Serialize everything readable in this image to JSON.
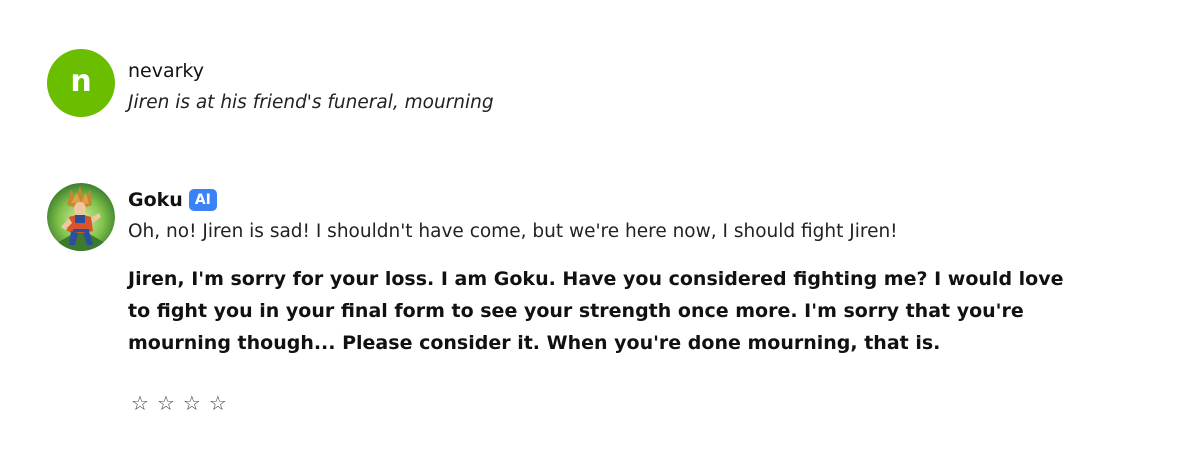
{
  "messages": [
    {
      "author": "nevarky",
      "avatar_letter": "n",
      "avatar_color": "#6bbd00",
      "text": "Jiren is at his friend's funeral, mourning"
    },
    {
      "author": "Goku",
      "badge": "AI",
      "badge_color": "#3b82f6",
      "avatar_icon": "goku-portrait",
      "line1": "Oh, no! Jiren is sad! I shouldn't have come, but we're here now, I should fight Jiren!",
      "line2": "Jiren, I'm sorry for your loss. I am Goku. Have you considered fighting me? I would love to fight you in your final form to see your strength once more. I'm sorry that you're mourning though... Please consider it. When you're done mourning, that is.",
      "rating": {
        "stars": [
          "☆",
          "☆",
          "☆",
          "☆"
        ],
        "value": 0
      }
    }
  ]
}
